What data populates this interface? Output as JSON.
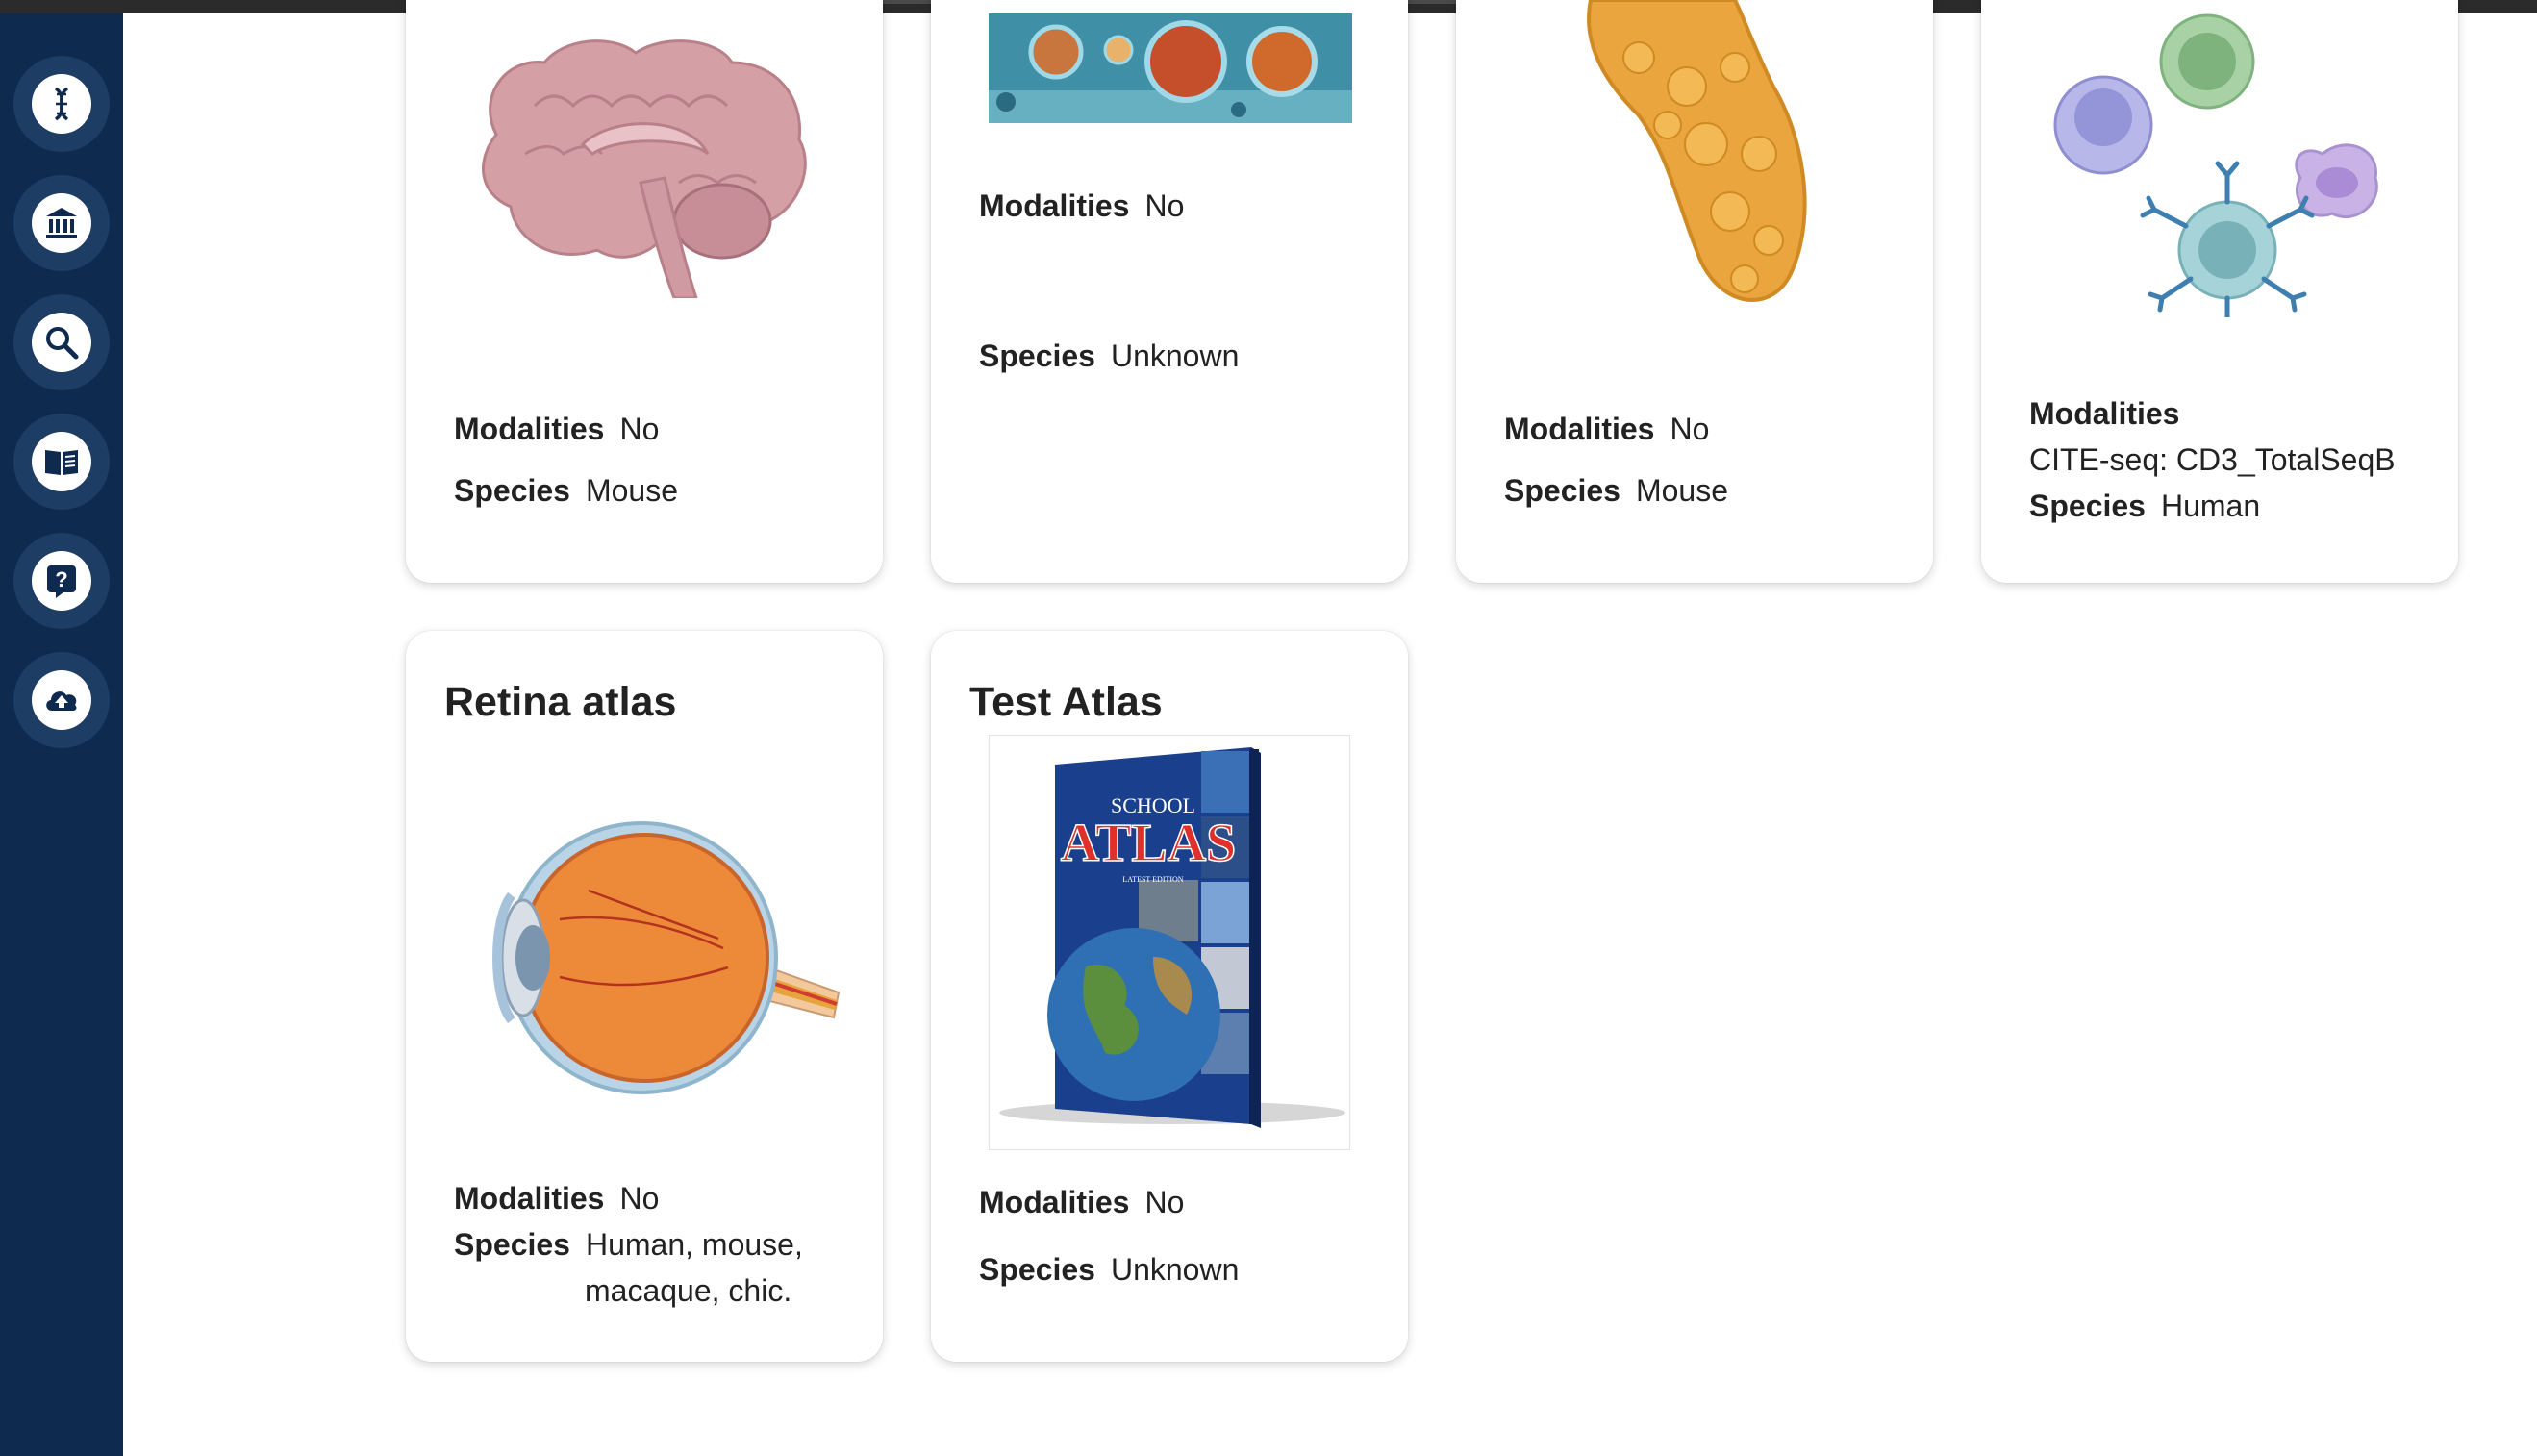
{
  "sidebar": {
    "items": [
      {
        "name": "dna",
        "icon": "dna-icon"
      },
      {
        "name": "institution",
        "icon": "bank-icon"
      },
      {
        "name": "search",
        "icon": "search-icon"
      },
      {
        "name": "documentation",
        "icon": "book-icon"
      },
      {
        "name": "help",
        "icon": "help-icon"
      },
      {
        "name": "upload",
        "icon": "cloud-upload-icon"
      }
    ]
  },
  "cards": [
    {
      "modalities_label": "Modalities",
      "modalities": "No",
      "species_label": "Species",
      "species": "Mouse",
      "image": "brain"
    },
    {
      "modalities_label": "Modalities",
      "modalities": "No",
      "species_label": "Species",
      "species": "Unknown",
      "image": "cells"
    },
    {
      "modalities_label": "Modalities",
      "modalities": "No",
      "species_label": "Species",
      "species": "Mouse",
      "image": "pancreas"
    },
    {
      "modalities_label": "Modalities",
      "modalities": "CITE-seq: CD3_TotalSeqB",
      "species_label": "Species",
      "species": "Human",
      "image": "immune-cells"
    },
    {
      "title": "Retina atlas",
      "modalities_label": "Modalities",
      "modalities": "No",
      "species_label": "Species",
      "species": "Human, mouse, macaque, chic.",
      "image": "eye"
    },
    {
      "title": "Test Atlas",
      "modalities_label": "Modalities",
      "modalities": "No",
      "species_label": "Species",
      "species": "Unknown",
      "image": "school-atlas-book",
      "book_top": "SCHOOL",
      "book_main": "ATLAS",
      "book_sub": "LATEST EDITION"
    }
  ],
  "colors": {
    "sidebar": "#0e2a4e",
    "accent": "#1d3d64"
  }
}
